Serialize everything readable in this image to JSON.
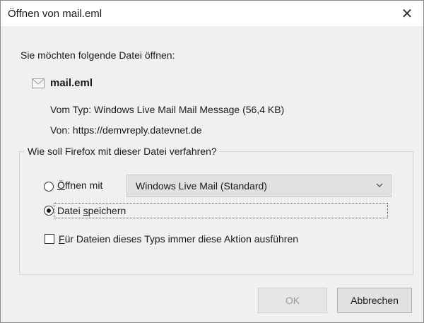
{
  "window": {
    "title": "Öffnen von mail.eml",
    "close_icon": "close-icon"
  },
  "info": {
    "heading": "Sie möchten folgende Datei öffnen:",
    "file_icon": "email-file-icon",
    "filename": "mail.eml",
    "type_label": "Vom Typ:",
    "type_value": "Windows Live Mail Mail Message (56,4 KB)",
    "from_label": "Von:",
    "from_value": "https://demvreply.datevnet.de"
  },
  "action": {
    "legend": "Wie soll Firefox mit dieser Datei verfahren?",
    "open_with": {
      "accesskey": "Ö",
      "rest": "ffnen mit",
      "selected": false
    },
    "app_select": {
      "value": "Windows Live Mail (Standard)",
      "icon": "chevron-down-icon"
    },
    "save_file": {
      "pre": "Datei ",
      "accesskey": "s",
      "rest": "peichern",
      "selected": true
    },
    "always_checkbox": {
      "accesskey": "F",
      "rest": "ür Dateien dieses Typs immer diese Aktion ausführen",
      "checked": false
    }
  },
  "buttons": {
    "ok": "OK",
    "cancel": "Abbrechen"
  }
}
